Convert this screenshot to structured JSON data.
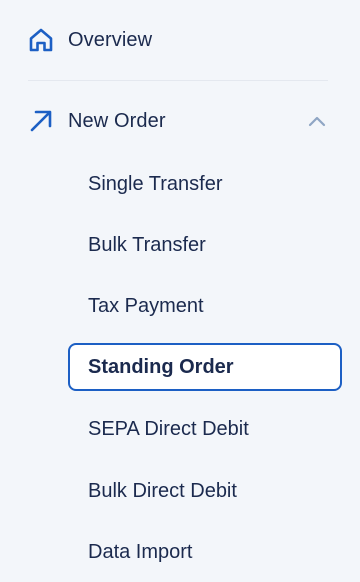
{
  "nav": {
    "overview": {
      "label": "Overview",
      "icon": "home-icon"
    },
    "new_order": {
      "label": "New Order",
      "icon": "arrow-up-right-icon",
      "expanded": true
    },
    "subitems": [
      {
        "label": "Single Transfer",
        "active": false
      },
      {
        "label": "Bulk Transfer",
        "active": false
      },
      {
        "label": "Tax Payment",
        "active": false
      },
      {
        "label": "Standing Order",
        "active": true
      },
      {
        "label": "SEPA Direct Debit",
        "active": false
      },
      {
        "label": "Bulk Direct Debit",
        "active": false
      },
      {
        "label": "Data Import",
        "active": false
      }
    ]
  },
  "colors": {
    "accent": "#1c5fc4",
    "text": "#1b2a4e",
    "background": "#f3f6fa",
    "chevron": "#8fa6c4"
  }
}
